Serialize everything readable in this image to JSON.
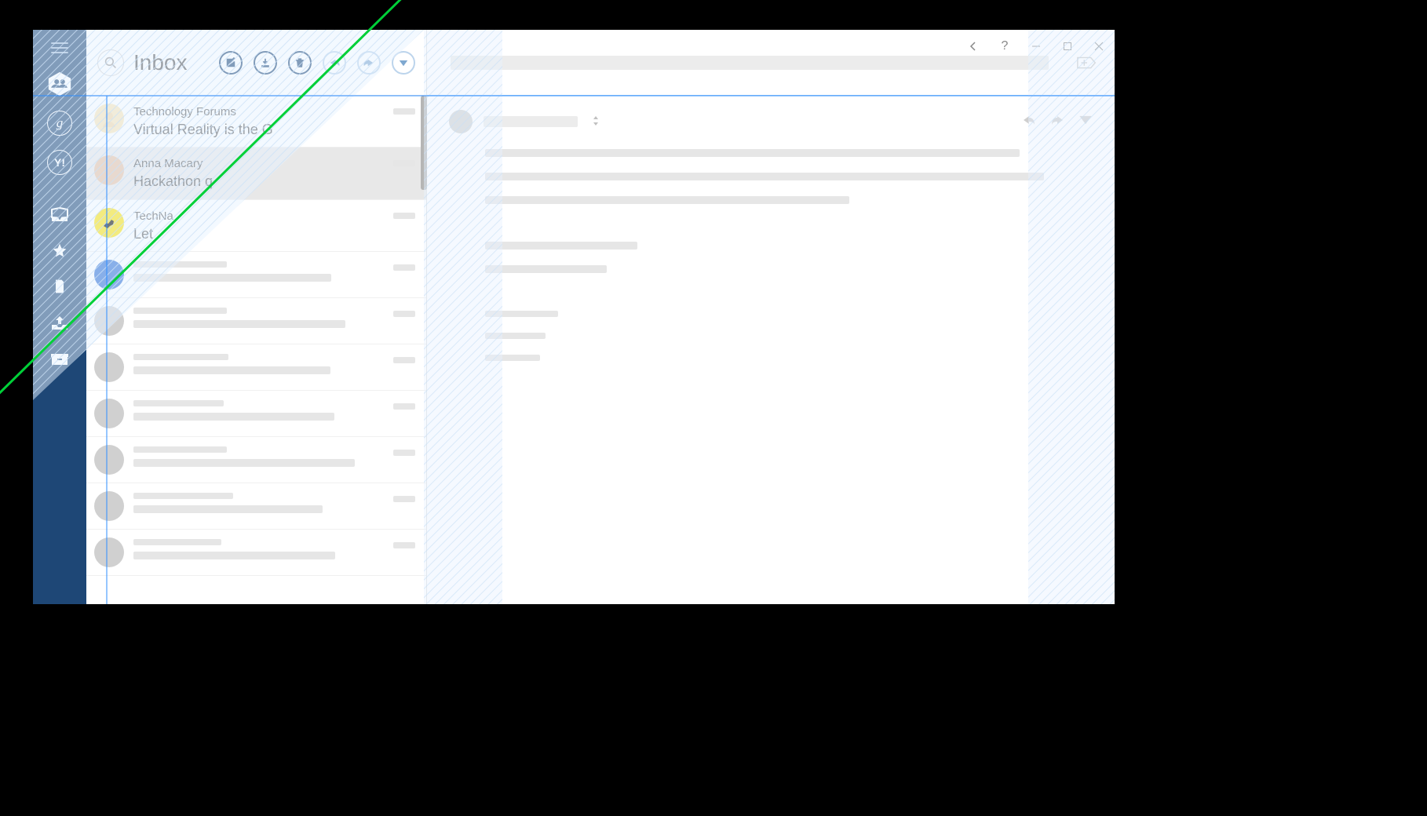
{
  "header": {
    "title": "Inbox"
  },
  "sidebar": {
    "accounts": [
      "common",
      "google",
      "yahoo"
    ],
    "folders": [
      "inbox",
      "starred",
      "drafts",
      "sent",
      "archive"
    ]
  },
  "toolbar": {
    "compose": "Compose",
    "download": "Download",
    "delete": "Delete",
    "reply": "Reply",
    "forward": "Forward",
    "more": "More"
  },
  "window": {
    "back": "Back",
    "help": "?",
    "minimize": "Minimize",
    "maximize": "Maximize",
    "close": "Close"
  },
  "messages": [
    {
      "sender": "Technology Forums",
      "subject": "Virtual Reality is the G",
      "avatar_bg": "#fbe6b5",
      "avatar_fg": "#c49a00",
      "selected": false,
      "placeholder": false
    },
    {
      "sender": "Anna Macary",
      "subject": "Hackathon q",
      "avatar_bg": "#e9c1a0",
      "avatar_fg": "#9b6a3b",
      "selected": true,
      "placeholder": false
    },
    {
      "sender": "TechNa",
      "subject": "Let",
      "avatar_bg": "#ffe400",
      "avatar_fg": "#000",
      "selected": false,
      "placeholder": false
    },
    {
      "sender": "",
      "subject": "",
      "avatar_bg": "#2b6ed4",
      "avatar_fg": "#fff",
      "selected": false,
      "placeholder": true
    },
    {
      "sender": "",
      "subject": "",
      "avatar_bg": "#d0d0d0",
      "avatar_fg": "#fff",
      "selected": false,
      "placeholder": true
    },
    {
      "sender": "",
      "subject": "",
      "avatar_bg": "#d0d0d0",
      "avatar_fg": "#fff",
      "selected": false,
      "placeholder": true
    },
    {
      "sender": "",
      "subject": "",
      "avatar_bg": "#d0d0d0",
      "avatar_fg": "#fff",
      "selected": false,
      "placeholder": true
    },
    {
      "sender": "",
      "subject": "",
      "avatar_bg": "#d0d0d0",
      "avatar_fg": "#fff",
      "selected": false,
      "placeholder": true
    },
    {
      "sender": "",
      "subject": "",
      "avatar_bg": "#d0d0d0",
      "avatar_fg": "#fff",
      "selected": false,
      "placeholder": true
    },
    {
      "sender": "",
      "subject": "",
      "avatar_bg": "#d0d0d0",
      "avatar_fg": "#fff",
      "selected": false,
      "placeholder": true
    }
  ],
  "colors": {
    "sidebar_bg": "#1e4776",
    "accent": "#2b8cff",
    "overlay_green": "#00d038"
  }
}
